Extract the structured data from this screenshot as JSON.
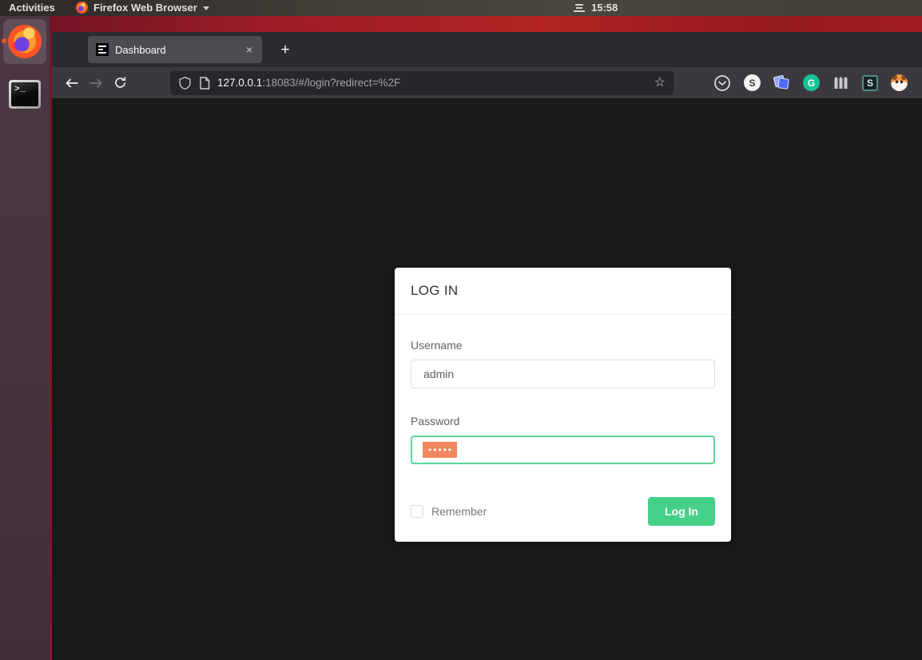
{
  "topbar": {
    "activities": "Activities",
    "app_menu": "Firefox Web Browser",
    "clock": "15:58"
  },
  "dock": {
    "terminal_glyph": ">_"
  },
  "browser": {
    "tab_title": "Dashboard",
    "tab_close": "×",
    "new_tab": "+",
    "url_host": "127.0.0.1",
    "url_rest": ":18083/#/login?redirect=%2F",
    "bookmark_star": "☆",
    "extensions": {
      "s_badge_letter": "S",
      "grammarly_letter": "G",
      "stylus_letter": "S"
    }
  },
  "login": {
    "title": "LOG IN",
    "username_label": "Username",
    "username_value": "admin",
    "password_label": "Password",
    "password_masked": "•••••",
    "remember_label": "Remember",
    "submit_label": "Log In"
  },
  "colors": {
    "accent_green": "#45d089",
    "focus_border_green": "#57d89a",
    "selection_orange": "#f0875f",
    "wallpaper_red": "#b32422",
    "dock_aubergine": "#45343f",
    "page_background": "#1a1a1a"
  }
}
